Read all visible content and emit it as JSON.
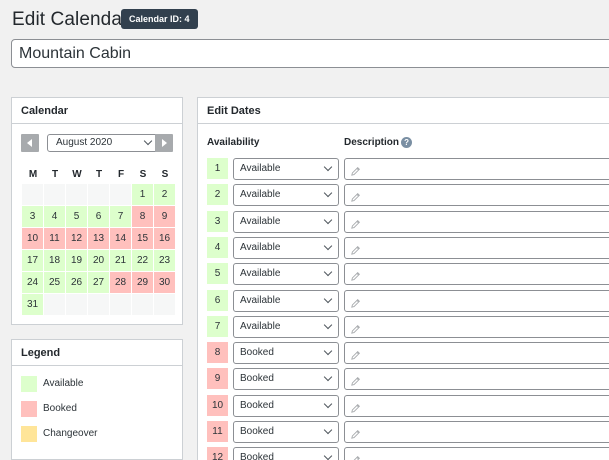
{
  "header": {
    "title": "Edit Calendar",
    "id_badge": "Calendar ID: 4"
  },
  "calendar_name": {
    "value": "Mountain Cabin"
  },
  "calendar_panel": {
    "title": "Calendar",
    "month": "August 2020",
    "weekdays": [
      "M",
      "T",
      "W",
      "T",
      "F",
      "S",
      "S"
    ],
    "leading_empty": 5,
    "trailing_empty": 6,
    "days": [
      {
        "n": "1",
        "s": "available"
      },
      {
        "n": "2",
        "s": "available"
      },
      {
        "n": "3",
        "s": "available"
      },
      {
        "n": "4",
        "s": "available"
      },
      {
        "n": "5",
        "s": "available"
      },
      {
        "n": "6",
        "s": "available"
      },
      {
        "n": "7",
        "s": "available"
      },
      {
        "n": "8",
        "s": "booked"
      },
      {
        "n": "9",
        "s": "booked"
      },
      {
        "n": "10",
        "s": "booked"
      },
      {
        "n": "11",
        "s": "booked"
      },
      {
        "n": "12",
        "s": "booked"
      },
      {
        "n": "13",
        "s": "booked"
      },
      {
        "n": "14",
        "s": "booked"
      },
      {
        "n": "15",
        "s": "booked"
      },
      {
        "n": "16",
        "s": "booked"
      },
      {
        "n": "17",
        "s": "available"
      },
      {
        "n": "18",
        "s": "available"
      },
      {
        "n": "19",
        "s": "available"
      },
      {
        "n": "20",
        "s": "available"
      },
      {
        "n": "21",
        "s": "available"
      },
      {
        "n": "22",
        "s": "available"
      },
      {
        "n": "23",
        "s": "available"
      },
      {
        "n": "24",
        "s": "available"
      },
      {
        "n": "25",
        "s": "available"
      },
      {
        "n": "26",
        "s": "available"
      },
      {
        "n": "27",
        "s": "available"
      },
      {
        "n": "28",
        "s": "booked"
      },
      {
        "n": "29",
        "s": "booked"
      },
      {
        "n": "30",
        "s": "booked"
      },
      {
        "n": "31",
        "s": "available"
      }
    ]
  },
  "legend": {
    "title": "Legend",
    "items": [
      {
        "label": "Available",
        "color": "#ddffcc"
      },
      {
        "label": "Booked",
        "color": "#ffc0bd"
      },
      {
        "label": "Changeover",
        "color": "#ffe599"
      }
    ]
  },
  "edit_dates": {
    "title": "Edit Dates",
    "col_availability": "Availability",
    "col_description": "Description",
    "help_icon": "?",
    "rows": [
      {
        "day": "1",
        "status": "Available",
        "state": "available"
      },
      {
        "day": "2",
        "status": "Available",
        "state": "available"
      },
      {
        "day": "3",
        "status": "Available",
        "state": "available"
      },
      {
        "day": "4",
        "status": "Available",
        "state": "available"
      },
      {
        "day": "5",
        "status": "Available",
        "state": "available"
      },
      {
        "day": "6",
        "status": "Available",
        "state": "available"
      },
      {
        "day": "7",
        "status": "Available",
        "state": "available"
      },
      {
        "day": "8",
        "status": "Booked",
        "state": "booked"
      },
      {
        "day": "9",
        "status": "Booked",
        "state": "booked"
      },
      {
        "day": "10",
        "status": "Booked",
        "state": "booked"
      },
      {
        "day": "11",
        "status": "Booked",
        "state": "booked"
      },
      {
        "day": "12",
        "status": "Booked",
        "state": "booked"
      }
    ]
  },
  "colors": {
    "available": "#ddffcc",
    "booked": "#ffc0bd",
    "changeover": "#ffe599",
    "badge": "#32404e"
  }
}
